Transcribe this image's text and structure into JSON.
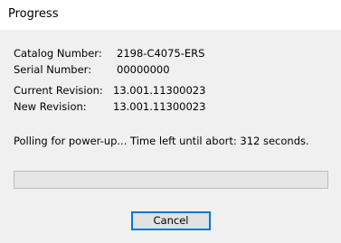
{
  "window": {
    "title": "Progress"
  },
  "info": {
    "catalog_label": "Catalog Number:",
    "catalog_value": "2198-C4075-ERS",
    "serial_label": "Serial Number:",
    "serial_value": "00000000",
    "current_rev_label": "Current Revision:",
    "current_rev_value": "13.001.11300023",
    "new_rev_label": "New Revision:",
    "new_rev_value": "13.001.11300023"
  },
  "status": {
    "text": "Polling for power-up... Time left until abort: 312 seconds."
  },
  "progress": {
    "fraction": 0
  },
  "buttons": {
    "cancel_label": "Cancel"
  },
  "colors": {
    "accent": "#0078d7",
    "background": "#f0f0f0",
    "progress_fill": "#06b025"
  }
}
